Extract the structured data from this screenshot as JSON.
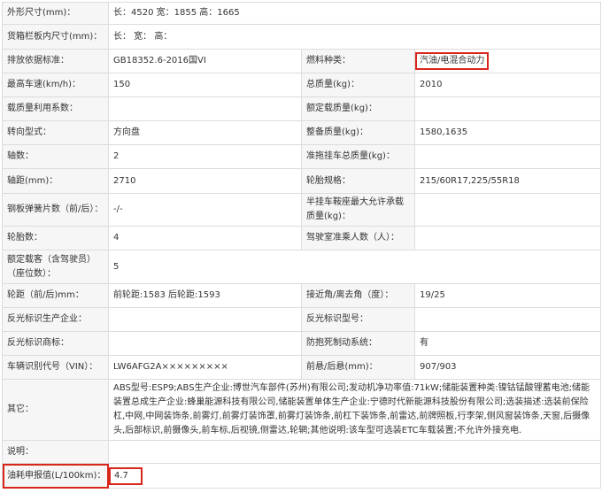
{
  "rows": [
    {
      "l1": "外形尺寸(mm)：",
      "v1": "长：4520 宽：1855 高：1665"
    },
    {
      "l1": "货箱栏板内尺寸(mm)：",
      "v1": "长： 宽： 高："
    },
    {
      "l1": "排放依据标准：",
      "v1": "GB18352.6-2016国VI",
      "l2": "燃料种类：",
      "v2": "汽油/电混合动力"
    },
    {
      "l1": "最高车速(km/h)：",
      "v1": "150",
      "l2": "总质量(kg)：",
      "v2": "2010"
    },
    {
      "l1": "载质量利用系数：",
      "v1": "",
      "l2": "额定载质量(kg)：",
      "v2": ""
    },
    {
      "l1": "转向型式：",
      "v1": "方向盘",
      "l2": "整备质量(kg)：",
      "v2": "1580,1635"
    },
    {
      "l1": "轴数：",
      "v1": "2",
      "l2": "准拖挂车总质量(kg)：",
      "v2": ""
    },
    {
      "l1": "轴距(mm)：",
      "v1": "2710",
      "l2": "轮胎规格：",
      "v2": "215/60R17,225/55R18"
    },
    {
      "l1": "钢板弹簧片数（前/后）：",
      "v1": "-/-",
      "l2": "半挂车鞍座最大允许承载质量(kg)：",
      "v2": ""
    },
    {
      "l1": "轮胎数：",
      "v1": "4",
      "l2": "驾驶室准乘人数（人）：",
      "v2": ""
    },
    {
      "l1": "额定载客（含驾驶员）（座位数）：",
      "v1": "5"
    },
    {
      "l1": "轮距（前/后)mm：",
      "v1": "前轮距:1583 后轮距:1593",
      "l2": "接近角/离去角（度）：",
      "v2": "19/25"
    },
    {
      "l1": "反光标识生产企业：",
      "v1": "",
      "l2": "反光标识型号：",
      "v2": ""
    },
    {
      "l1": "反光标识商标：",
      "v1": "",
      "l2": "防抱死制动系统：",
      "v2": "有"
    },
    {
      "l1": "车辆识别代号（VIN）：",
      "v1": "LW6AFG2A×××××××××",
      "l2": "前悬/后悬(mm)：",
      "v2": "907/903"
    },
    {
      "l1": "其它：",
      "v1": "ABS型号:ESP9;ABS生产企业:博世汽车部件(苏州)有限公司;发动机净功率值:71kW;储能装置种类:镍钴锰酸锂蓄电池;储能装置总成生产企业:蜂巢能源科技有限公司,储能装置单体生产企业:宁德时代新能源科技股份有限公司;选装描述:选装前保险杠,中网,中网装饰条,前雾灯,前雾灯装饰罩,前雾灯装饰条,前杠下装饰条,前雷达,前牌照板,行李架,侧风窗装饰条,天窗,后摄像头,后部标识,前摄像头,前车标,后视镜,侧雷达,轮辋;其他说明:该车型可选装ETC车载装置;不允许外接充电."
    },
    {
      "l1": "说明：",
      "v1": ""
    },
    {
      "l1": "油耗申报值(L/100km)：",
      "v1": "4.7"
    }
  ]
}
